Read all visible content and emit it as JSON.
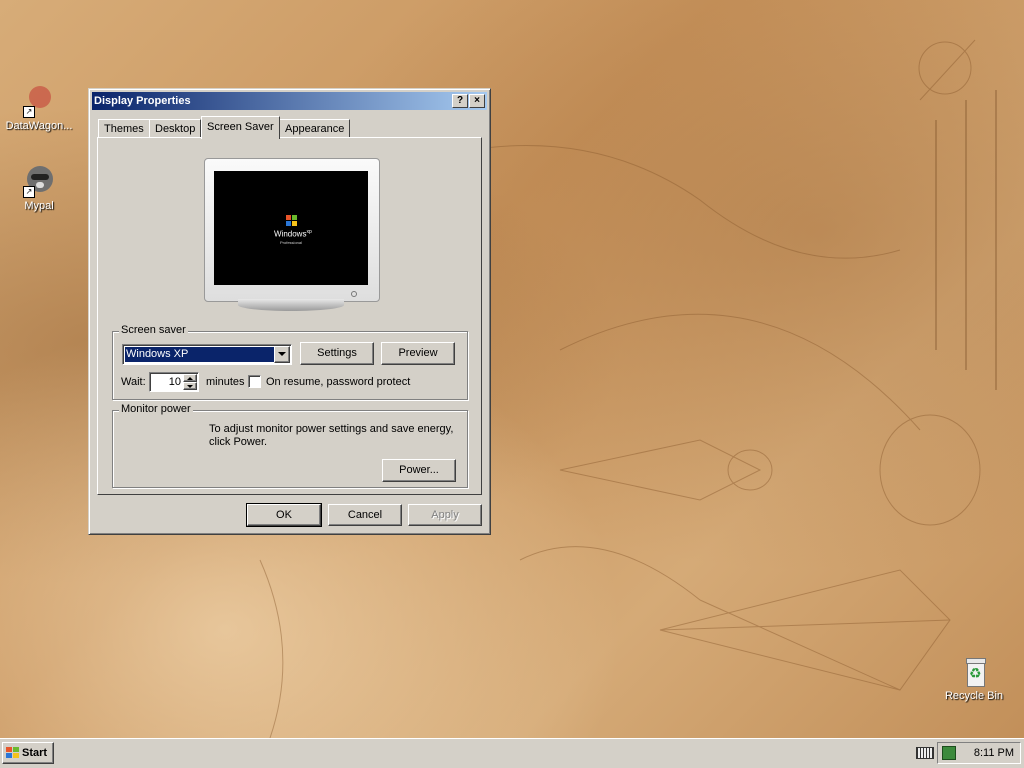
{
  "desktop": {
    "icons": [
      {
        "label": "DataWagon...",
        "icon": "datawagon-shortcut-icon"
      },
      {
        "label": "Mypal",
        "icon": "mypal-shortcut-icon"
      },
      {
        "label": "Recycle Bin",
        "icon": "recycle-bin-icon"
      }
    ]
  },
  "window": {
    "title": "Display Properties",
    "help_glyph": "?",
    "close_glyph": "×",
    "tabs": [
      "Themes",
      "Desktop",
      "Screen Saver",
      "Appearance"
    ],
    "active_tab": "Screen Saver",
    "preview": {
      "logo_text": "Windows",
      "logo_sup": "xp",
      "logo_edition": "Professional"
    },
    "screen_saver": {
      "group_label": "Screen saver",
      "selected": "Windows XP",
      "settings_label": "Settings",
      "preview_label": "Preview",
      "wait_label": "Wait:",
      "wait_value": "10",
      "minutes_label": "minutes",
      "password_label": "On resume, password protect",
      "password_checked": false
    },
    "monitor_power": {
      "group_label": "Monitor power",
      "description": "To adjust monitor power settings and save energy, click Power.",
      "power_label": "Power..."
    },
    "buttons": {
      "ok": "OK",
      "cancel": "Cancel",
      "apply": "Apply"
    }
  },
  "taskbar": {
    "start_label": "Start",
    "clock": "8:11 PM"
  },
  "colors": {
    "title_active_start": "#0a246a",
    "title_active_end": "#a6caf0",
    "face": "#d4d0c8",
    "selection": "#0a246a"
  }
}
